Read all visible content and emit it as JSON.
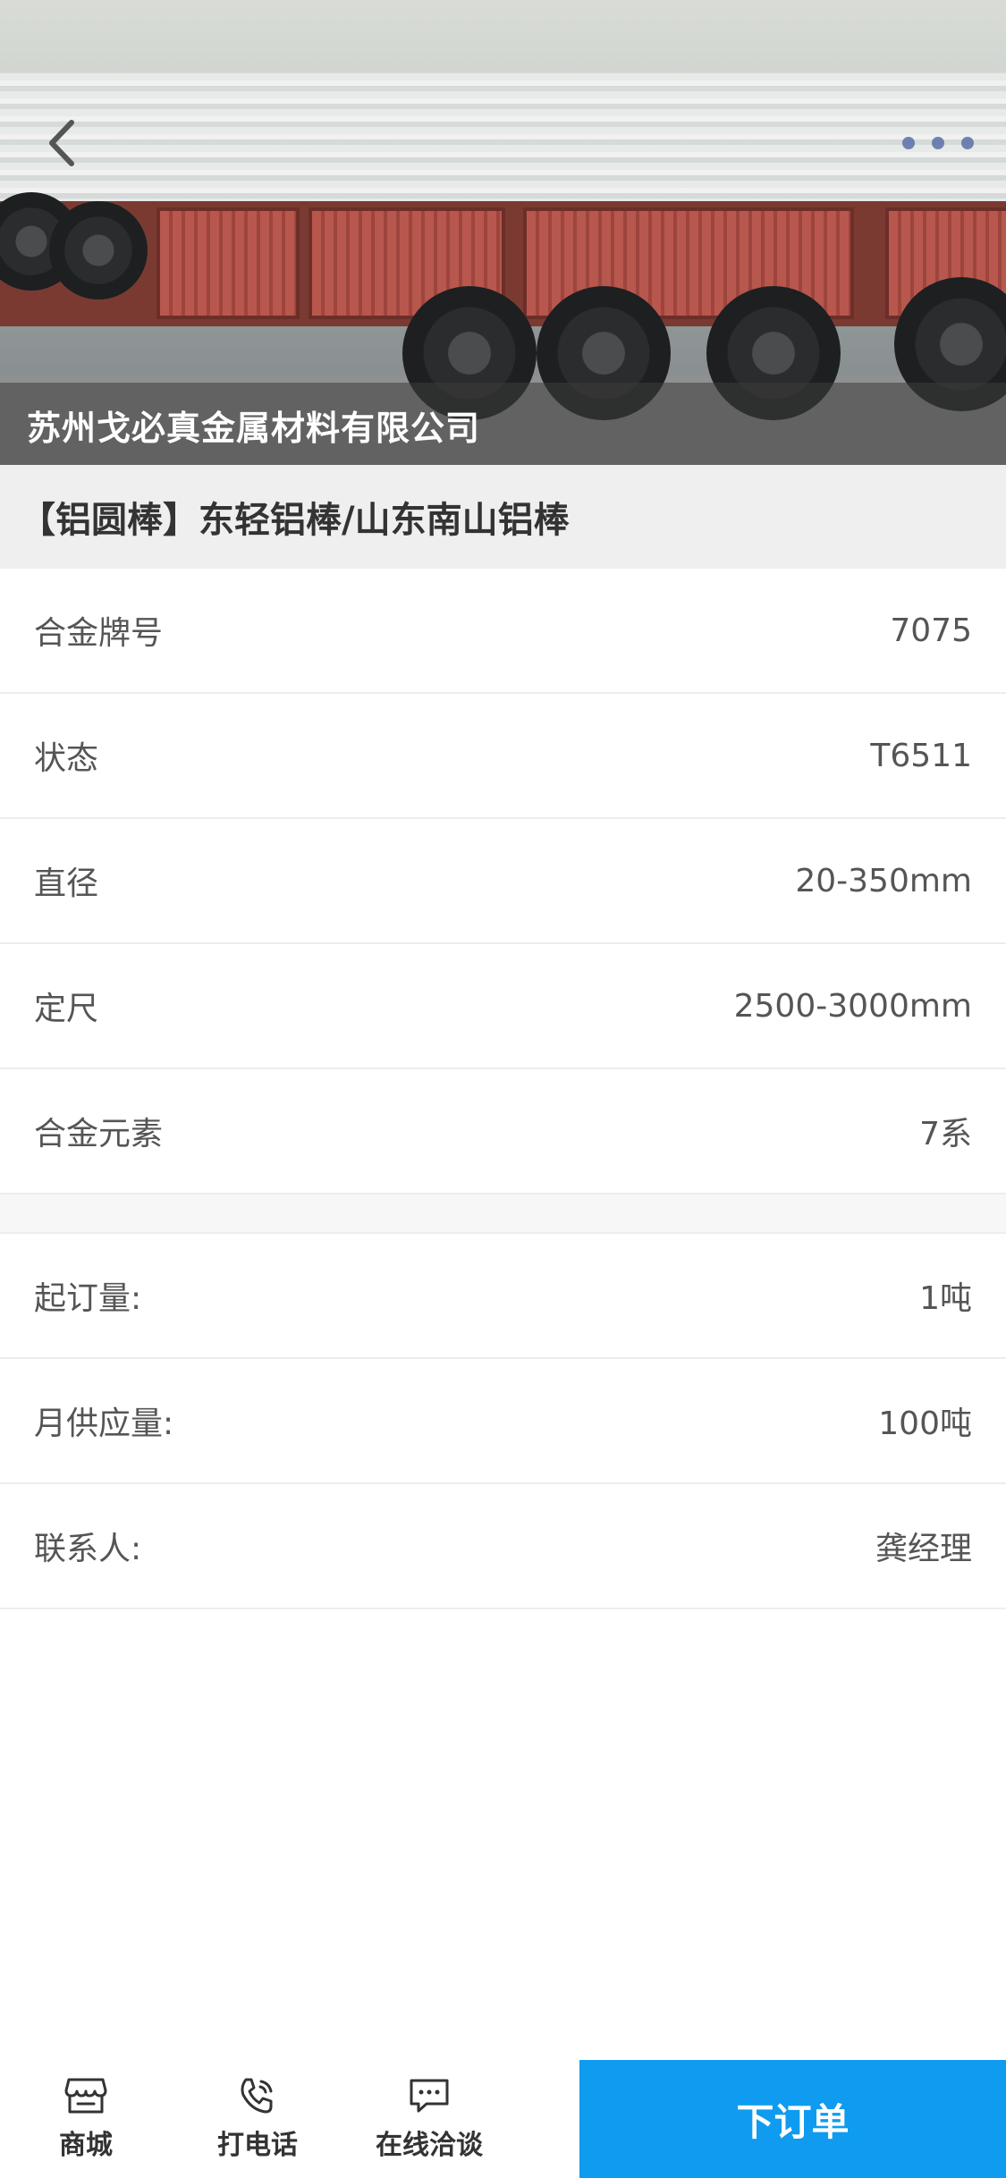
{
  "hero": {
    "company": "苏州戈必真金属材料有限公司"
  },
  "product": {
    "title": "【铝圆棒】东轻铝棒/山东南山铝棒"
  },
  "specs": [
    {
      "label": "合金牌号",
      "value": "7075"
    },
    {
      "label": "状态",
      "value": "T6511"
    },
    {
      "label": "直径",
      "value": "20-350mm"
    },
    {
      "label": "定尺",
      "value": "2500-3000mm"
    },
    {
      "label": "合金元素",
      "value": "7系"
    }
  ],
  "supply": [
    {
      "label": "起订量:",
      "value": "1吨"
    },
    {
      "label": "月供应量:",
      "value": "100吨"
    },
    {
      "label": "联系人:",
      "value": "龚经理"
    }
  ],
  "bottom_bar": {
    "tabs": [
      {
        "label": "商城",
        "icon": "shop-icon"
      },
      {
        "label": "打电话",
        "icon": "phone-icon"
      },
      {
        "label": "在线洽谈",
        "icon": "chat-icon"
      }
    ],
    "order_button": "下订单",
    "accent": "#0e9bf0"
  }
}
